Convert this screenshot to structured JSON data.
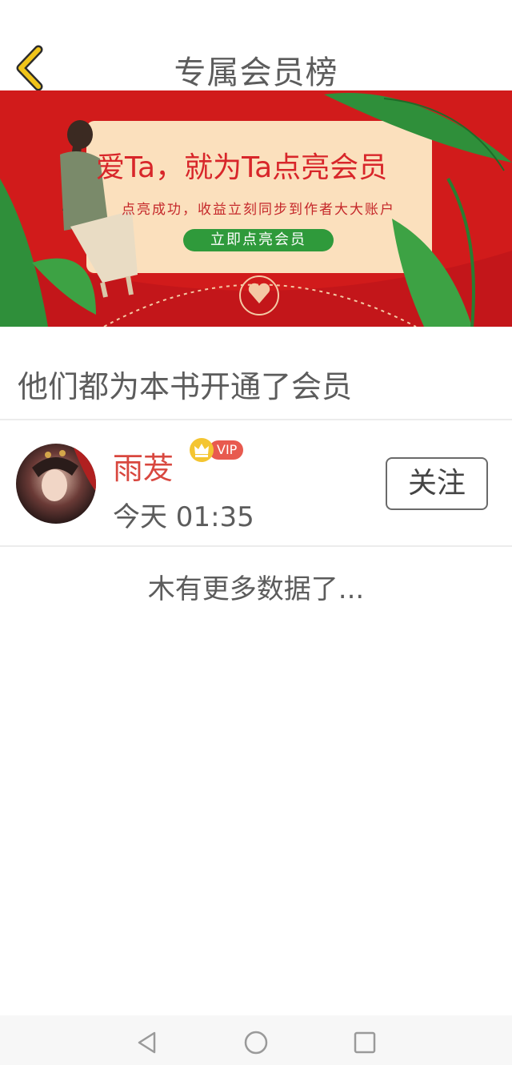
{
  "header": {
    "title": "专属会员榜"
  },
  "banner": {
    "headline": "爱Ta，就为Ta点亮会员",
    "subtitle": "点亮成功，收益立刻同步到作者大大账户",
    "button_label": "立即点亮会员"
  },
  "section": {
    "title": "他们都为本书开通了会员"
  },
  "members": [
    {
      "name": "雨茇",
      "badge": "VIP",
      "time": "今天 01:35",
      "follow_label": "关注"
    }
  ],
  "footer_message": "木有更多数据了...",
  "colors": {
    "banner_red": "#d11b1b",
    "name_red": "#d8473f",
    "back_arrow": "#f0c419",
    "green_button": "#2f9a3b"
  },
  "icons": {
    "back": "chevron-left-icon",
    "crown": "crown-icon",
    "nav_back": "triangle-back-icon",
    "nav_home": "circle-home-icon",
    "nav_recents": "square-recents-icon"
  }
}
